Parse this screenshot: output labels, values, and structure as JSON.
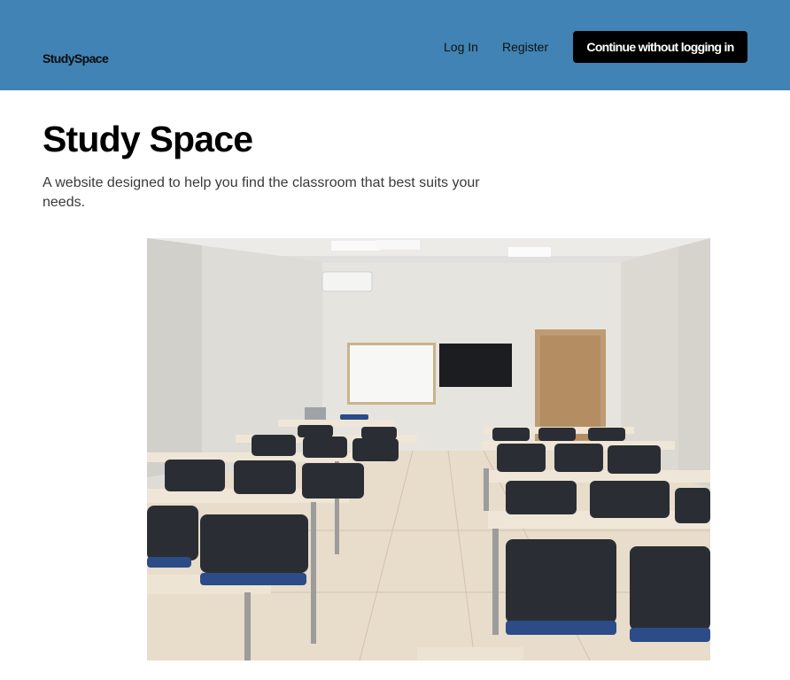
{
  "header": {
    "brand": "StudySpace",
    "nav": {
      "login": "Log In",
      "register": "Register"
    },
    "cta": "Continue without  logging in"
  },
  "hero": {
    "title": "Study Space",
    "description": "A website designed to help you find the classroom that best suits your needs."
  },
  "colors": {
    "header_bg": "#4083b4",
    "cta_bg": "#000000",
    "cta_text": "#ffffff"
  }
}
